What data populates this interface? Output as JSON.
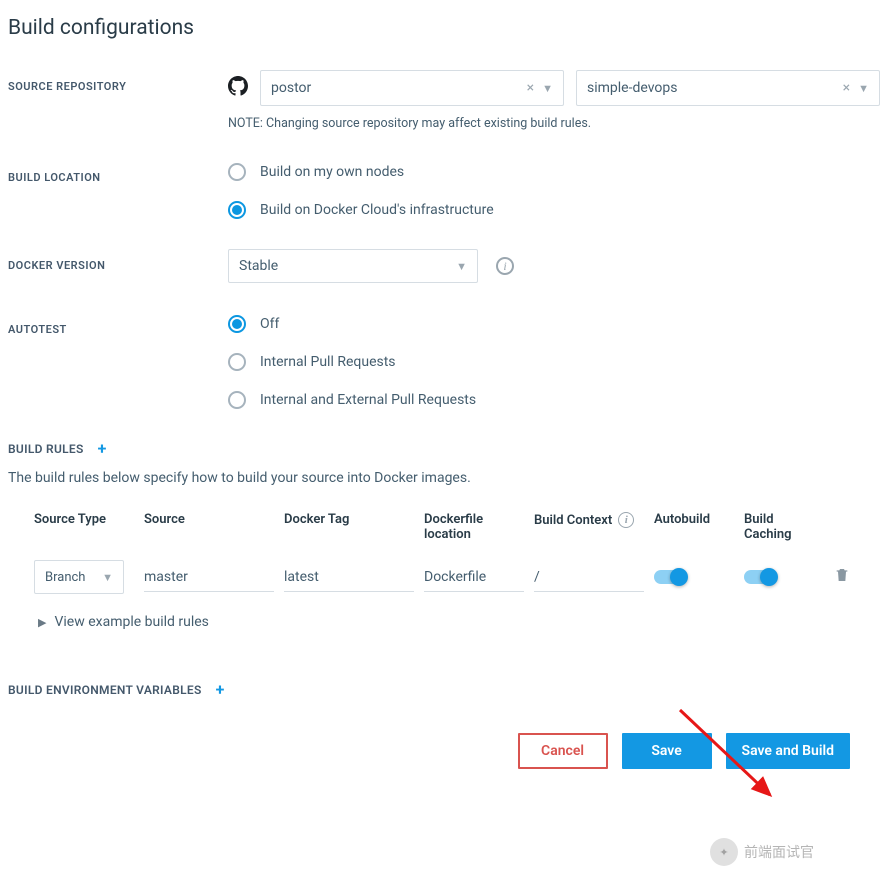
{
  "page": {
    "title": "Build configurations"
  },
  "sourceRepo": {
    "label": "SOURCE REPOSITORY",
    "owner": "postor",
    "repo": "simple-devops",
    "note": "NOTE: Changing source repository may affect existing build rules."
  },
  "buildLocation": {
    "label": "BUILD LOCATION",
    "options": {
      "own": "Build on my own nodes",
      "cloud": "Build on Docker Cloud's infrastructure"
    },
    "selected": "cloud"
  },
  "dockerVersion": {
    "label": "DOCKER VERSION",
    "value": "Stable"
  },
  "autotest": {
    "label": "AUTOTEST",
    "options": {
      "off": "Off",
      "internal": "Internal Pull Requests",
      "both": "Internal and External Pull Requests"
    },
    "selected": "off"
  },
  "buildRules": {
    "label": "BUILD RULES",
    "desc": "The build rules below specify how to build your source into Docker images.",
    "headers": {
      "sourceType": "Source Type",
      "source": "Source",
      "dockerTag": "Docker Tag",
      "dockerfileLocation": "Dockerfile location",
      "buildContext": "Build Context",
      "autobuild": "Autobuild",
      "buildCaching": "Build Caching"
    },
    "rows": [
      {
        "sourceType": "Branch",
        "source": "master",
        "dockerTag": "latest",
        "dockerfileLocation": "Dockerfile",
        "buildContext": "/",
        "autobuild": true,
        "buildCaching": true
      }
    ],
    "exampleLink": "View example build rules"
  },
  "envVars": {
    "label": "BUILD ENVIRONMENT VARIABLES"
  },
  "buttons": {
    "cancel": "Cancel",
    "save": "Save",
    "saveAndBuild": "Save and Build"
  },
  "watermark": "前端面试官"
}
